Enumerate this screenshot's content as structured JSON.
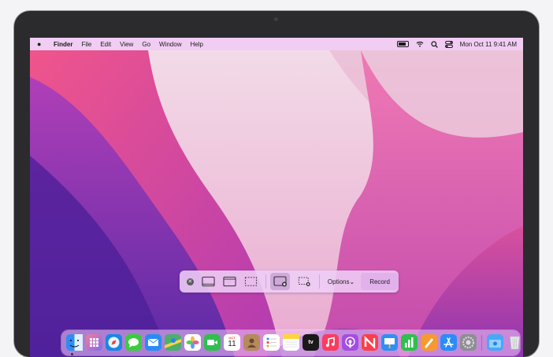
{
  "menubar": {
    "apple_icon": "apple-logo-icon",
    "app_name": "Finder",
    "menus": [
      "File",
      "Edit",
      "View",
      "Go",
      "Window",
      "Help"
    ],
    "datetime": "Mon Oct 11  9:41 AM"
  },
  "screenshot_toolbar": {
    "options_label": "Options",
    "options_caret": "⌄",
    "record_label": "Record"
  },
  "dock": {
    "calendar_month": "OCT",
    "calendar_day": "11",
    "tv_label": "tv",
    "colors": {
      "finder": "#2e8cf3",
      "launchpad": "#e85d84",
      "safari": "#1a86e6",
      "messages": "#3ccb3f",
      "mail": "#2b8bf5",
      "maps": "#4caf6a",
      "photos": "#f6b340",
      "facetime": "#2fbf4e",
      "calendar": "#ffffff",
      "contacts": "#b58a5d",
      "reminders": "#ffffff",
      "notes": "#ffd43a",
      "tv": "#1a1a1a",
      "music": "#fb3c5d",
      "podcasts": "#a44ee0",
      "news": "#fa3f4a",
      "keynote": "#2f8ff5",
      "numbers": "#2fbf4e",
      "pages": "#f69a2f",
      "appstore": "#2c8cf5",
      "settings": "#8e8e93",
      "downloads": "#4aa7f5",
      "trash": "#e6e6ea"
    }
  }
}
